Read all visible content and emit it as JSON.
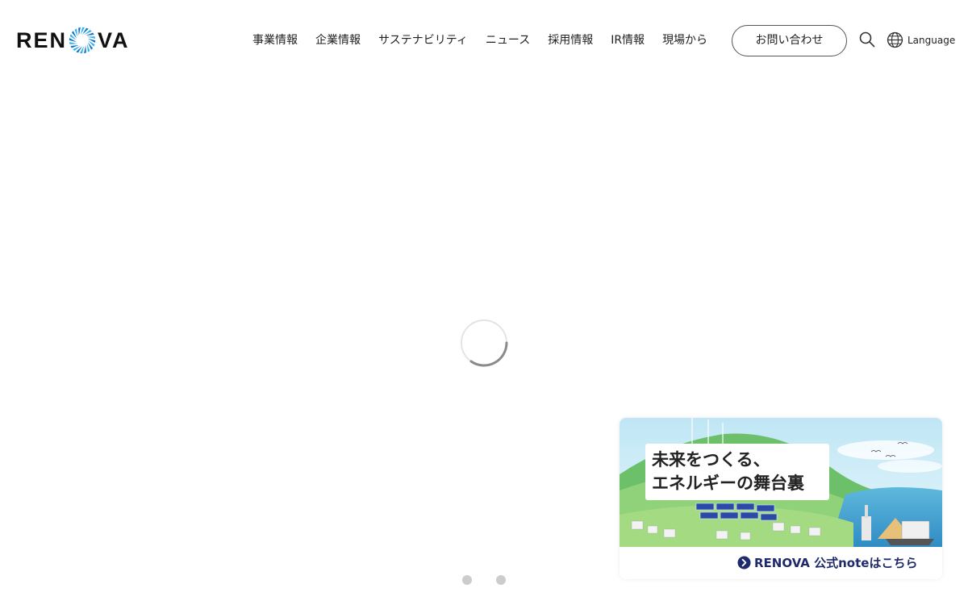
{
  "header": {
    "logo_text_left": "REN",
    "logo_text_right": "VA",
    "logo_alt": "RENOVA",
    "nav": [
      {
        "label": "事業情報"
      },
      {
        "label": "企業情報"
      },
      {
        "label": "サステナビリティ"
      },
      {
        "label": "ニュース"
      },
      {
        "label": "採用情報"
      },
      {
        "label": "IR情報"
      },
      {
        "label": "現場から"
      }
    ],
    "contact_label": "お問い合わせ",
    "search_icon": "search-icon",
    "language_icon": "globe-icon",
    "language_label": "Language"
  },
  "hero": {
    "loading_icon": "spinner-icon"
  },
  "banner": {
    "title": "未来をつくる、\nエネルギーの舞台裏",
    "link_label": "RENOVA 公式noteはこちら",
    "link_icon": "chevron-circle-right-icon",
    "accent": "#1f2a6b"
  },
  "slider": {
    "dots": 2
  },
  "colors": {
    "logo_blue": "#1a6fd1",
    "logo_cyan": "#29b6e8",
    "dot_inactive": "#cccccc"
  }
}
